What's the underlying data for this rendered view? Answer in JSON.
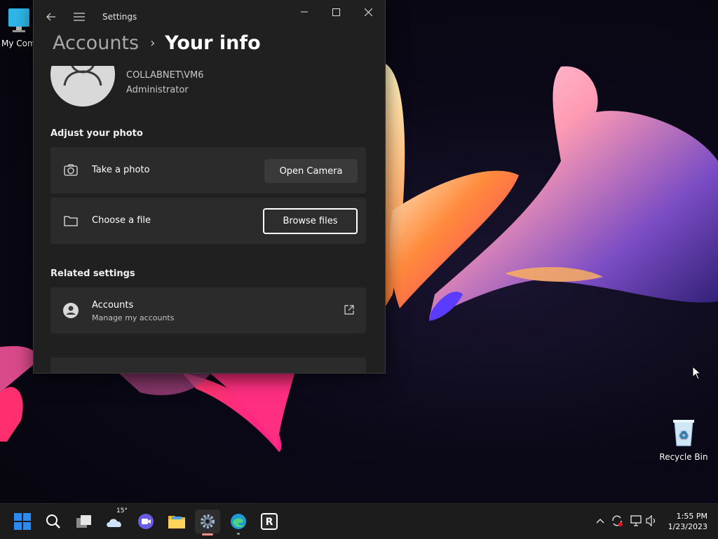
{
  "desktop": {
    "icons": [
      {
        "label": "My Com"
      },
      {
        "label": "Recycle Bin"
      }
    ]
  },
  "window": {
    "app_title": "Settings",
    "breadcrumb": {
      "parent": "Accounts",
      "separator": "›",
      "current": "Your info"
    },
    "user": {
      "domain": "COLLABNET\\VM6",
      "role": "Administrator"
    },
    "adjust_photo": {
      "title": "Adjust your photo",
      "take_photo": {
        "label": "Take a photo",
        "button": "Open Camera"
      },
      "choose_file": {
        "label": "Choose a file",
        "button": "Browse files"
      }
    },
    "related": {
      "title": "Related settings",
      "accounts": {
        "title": "Accounts",
        "subtitle": "Manage my accounts"
      }
    }
  },
  "taskbar": {
    "weather_temp": "15°",
    "clock": {
      "time": "1:55 PM",
      "date": "1/23/2023"
    },
    "pinned": [
      "start-icon",
      "search-icon",
      "task-view-icon",
      "weather-icon",
      "meet-icon",
      "file-explorer-icon",
      "settings-icon",
      "edge-icon",
      "app-r-icon"
    ]
  },
  "colors": {
    "accent_start": "#2b8bf2",
    "settings_indicator": "#ff8f8f",
    "window_bg": "#202020",
    "card_bg": "#2b2b2b"
  }
}
